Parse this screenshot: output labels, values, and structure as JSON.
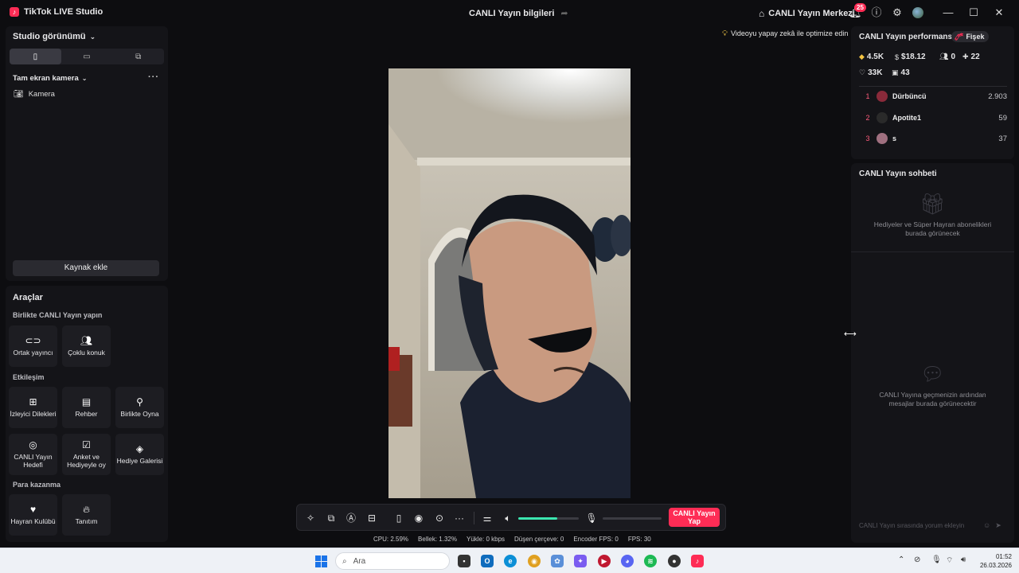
{
  "titlebar": {
    "app_name": "TikTok LIVE Studio",
    "center_title": "CANLI Yayın bilgileri",
    "live_center": "CANLI Yayın Merkezi",
    "notification_count": "25"
  },
  "studio": {
    "title": "Studio görünümü",
    "scene": "Tam ekran kamera",
    "source": "Kamera",
    "add_source": "Kaynak ekle"
  },
  "tools": {
    "title": "Araçlar",
    "section_together": "Birlikte CANLI Yayın yapın",
    "section_engage": "Etkileşim",
    "section_money": "Para kazanma",
    "together": [
      "Ortak yayıncı",
      "Çoklu konuk"
    ],
    "engage": [
      "İzleyici Dilekleri",
      "Rehber",
      "Birlikte Oyna",
      "CANLI Yayın Hedefi",
      "Anket ve Hediyeyle oy",
      "Hediye Galerisi"
    ],
    "money": [
      "Hayran Kulübü",
      "Tanıtım"
    ]
  },
  "ai_tip": "Videoyu yapay zekâ ile optimize edin",
  "controls": {
    "go_live": "CANLI Yayın Yap",
    "volume_level": 0.64,
    "mic_level": 0.0
  },
  "stats": {
    "cpu_label": "CPU:",
    "cpu": "2.59%",
    "mem_label": "Bellek:",
    "mem": "1.32%",
    "upload_label": "Yükle:",
    "upload": "0 kbps",
    "dropped_label": "Düşen çerçeve:",
    "dropped": "0",
    "enc_label": "Encoder FPS:",
    "enc": "0",
    "fps_label": "FPS:",
    "fps": "30"
  },
  "performance": {
    "title": "CANLI Yayın performansı",
    "badge": "Fişek",
    "diamonds": "4.5K",
    "earnings": "$18.12",
    "viewers": "0",
    "new_followers": "22",
    "likes": "33K",
    "gifters": "43",
    "ranking": [
      {
        "rank": "1",
        "name": "Dürbüncü",
        "score": "2.903",
        "color": "#8a2a3a"
      },
      {
        "rank": "2",
        "name": "Apotite1",
        "score": "59",
        "color": "#2a2a2a"
      },
      {
        "rank": "3",
        "name": "s",
        "score": "37",
        "color": "#a07080"
      }
    ]
  },
  "chat": {
    "title": "CANLI Yayın sohbeti",
    "gifts_empty": "Hediyeler ve Süper Hayran abonelikleri burada görünecek",
    "messages_empty": "CANLI Yayına geçmenizin ardından mesajlar burada görünecektir",
    "input_placeholder": "CANLI Yayın sırasında yorum ekleyin"
  },
  "taskbar": {
    "search": "Ara",
    "time": "01:52",
    "date": "26.03.2026"
  },
  "colors": {
    "accent": "#fe2c55",
    "volume": "#3be6b0",
    "panel": "#141418"
  }
}
